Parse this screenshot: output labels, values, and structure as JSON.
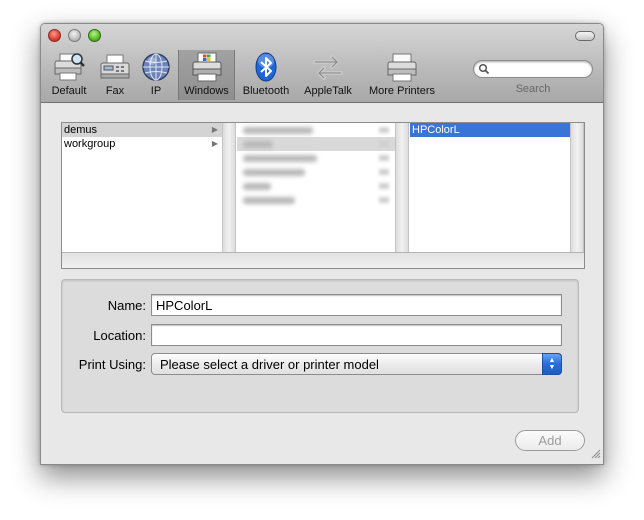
{
  "toolbar": {
    "items": [
      {
        "label": "Default",
        "icon": "printer-magnifier-icon"
      },
      {
        "label": "Fax",
        "icon": "fax-icon"
      },
      {
        "label": "IP",
        "icon": "globe-icon"
      },
      {
        "label": "Windows",
        "icon": "windows-printer-icon",
        "selected": true
      },
      {
        "label": "Bluetooth",
        "icon": "bluetooth-icon"
      },
      {
        "label": "AppleTalk",
        "icon": "appletalk-icon"
      },
      {
        "label": "More Printers",
        "icon": "printer-icon"
      }
    ],
    "search": {
      "label": "Search",
      "value": "",
      "icon": "search-icon"
    }
  },
  "browser": {
    "column1": [
      {
        "label": "demus",
        "selected": true,
        "has_children": true
      },
      {
        "label": "workgroup",
        "selected": false,
        "has_children": true
      }
    ],
    "column3": [
      {
        "label": "HPColorL",
        "selected": true
      }
    ]
  },
  "form": {
    "name_label": "Name:",
    "name_value": "HPColorL",
    "location_label": "Location:",
    "location_value": "",
    "print_using_label": "Print Using:",
    "print_using_value": "Please select a driver or printer model"
  },
  "add_button": {
    "label": "Add",
    "enabled": false
  },
  "colors": {
    "selection_blue": "#3875d7",
    "selection_gray": "#d4d4d4",
    "stepper_blue": "#2a6ed6"
  }
}
